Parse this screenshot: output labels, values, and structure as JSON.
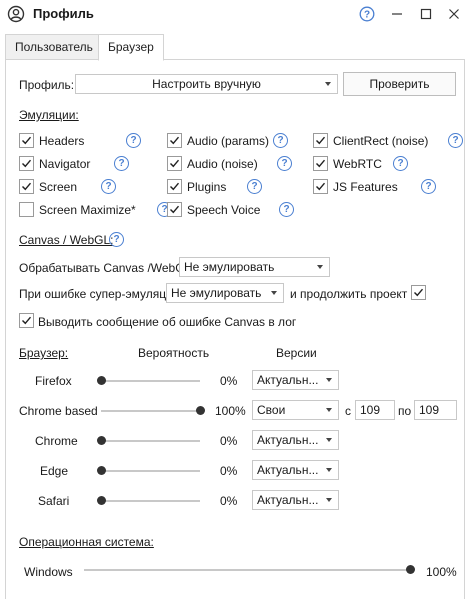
{
  "window": {
    "title": "Профиль",
    "icon": "user-circle-icon"
  },
  "tabs": [
    {
      "label": "Пользователь",
      "active": false
    },
    {
      "label": "Браузер",
      "active": true
    }
  ],
  "profile": {
    "label": "Профиль:",
    "value": "Настроить вручную",
    "check_button": "Проверить"
  },
  "emulation": {
    "title": "Эмуляции:",
    "items": [
      {
        "label": "Headers",
        "checked": true
      },
      {
        "label": "Audio (params)",
        "checked": true
      },
      {
        "label": "ClientRect (noise)",
        "checked": true
      },
      {
        "label": "Navigator",
        "checked": true
      },
      {
        "label": "Audio (noise)",
        "checked": true
      },
      {
        "label": "WebRTC",
        "checked": true
      },
      {
        "label": "Screen",
        "checked": true
      },
      {
        "label": "Plugins",
        "checked": true
      },
      {
        "label": "JS Features",
        "checked": true
      },
      {
        "label": "Screen Maximize*",
        "checked": false
      },
      {
        "label": "Speech Voice",
        "checked": true
      }
    ]
  },
  "canvas": {
    "title": "Canvas / WebGL:",
    "process_label": "Обрабатывать Canvas /WebGL",
    "process_value": "Не эмулировать",
    "error_label": "При ошибке супер-эмуляции",
    "error_value": "Не эмулировать",
    "continue_label": "и продолжить проект",
    "continue_checked": true,
    "log_label": "Выводить сообщение об ошибке Canvas в лог",
    "log_checked": true
  },
  "browser": {
    "title": "Браузер:",
    "col_probability": "Вероятность",
    "col_versions": "Версии",
    "rows": [
      {
        "name": "Firefox",
        "percent": "0%",
        "value": 0,
        "version": "Актуальн..."
      },
      {
        "name": "Chrome based",
        "percent": "100%",
        "value": 100,
        "version": "Свои",
        "from_label": "с",
        "from": "109",
        "to_label": "по",
        "to": "109"
      },
      {
        "name": "Chrome",
        "percent": "0%",
        "value": 0,
        "version": "Актуальн..."
      },
      {
        "name": "Edge",
        "percent": "0%",
        "value": 0,
        "version": "Актуальн..."
      },
      {
        "name": "Safari",
        "percent": "0%",
        "value": 0,
        "version": "Актуальн..."
      }
    ]
  },
  "os": {
    "title": "Операционная система:",
    "rows": [
      {
        "name": "Windows",
        "percent": "100%",
        "value": 100
      }
    ]
  },
  "colors": {
    "accent": "#4a7fd1",
    "border": "#c8c8c8",
    "thumb": "#333333"
  }
}
